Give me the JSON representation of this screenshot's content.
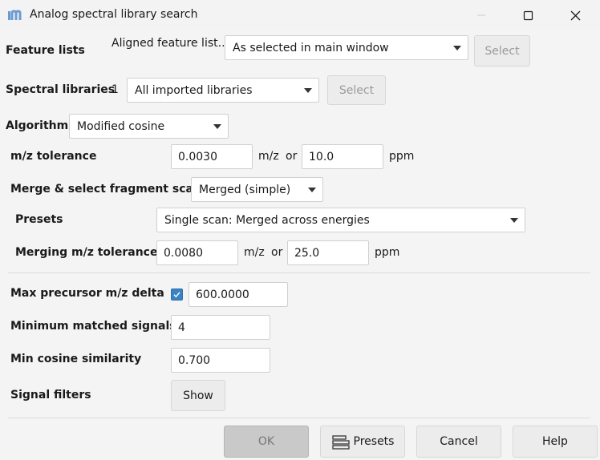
{
  "window": {
    "title": "Analog spectral library search",
    "app_icon": "mzmine-logo-icon",
    "controls": [
      "minimize-icon",
      "maximize-icon",
      "close-icon"
    ]
  },
  "feature_lists": {
    "label": "Feature lists",
    "sublabel": "Aligned feature list...",
    "combo_value": "As selected in main window",
    "select_label": "Select"
  },
  "spectral_libraries": {
    "label": "Spectral libraries",
    "count": "1",
    "combo_value": "All imported libraries",
    "select_label": "Select"
  },
  "algorithm": {
    "label": "Algorithm",
    "combo_value": "Modified cosine"
  },
  "mz_tolerance": {
    "label": "m/z tolerance",
    "mz_value": "0.0030",
    "mz_unit": "m/z",
    "or": "or",
    "ppm_value": "10.0",
    "ppm_unit": "ppm"
  },
  "merge": {
    "label": "Merge & select fragment scans",
    "combo_value": "Merged (simple)"
  },
  "presets": {
    "label": "Presets",
    "combo_value": "Single scan: Merged across energies"
  },
  "merging_mz_tolerance": {
    "label": "Merging m/z tolerance",
    "mz_value": "0.0080",
    "mz_unit": "m/z",
    "or": "or",
    "ppm_value": "25.0",
    "ppm_unit": "ppm"
  },
  "max_precursor": {
    "label": "Max precursor m/z delta",
    "checked": true,
    "value": "600.0000"
  },
  "min_matched": {
    "label": "Minimum matched signals",
    "value": "4"
  },
  "min_cosine": {
    "label": "Min cosine similarity",
    "value": "0.700"
  },
  "signal_filters": {
    "label": "Signal filters",
    "show_label": "Show"
  },
  "footer": {
    "ok_label": "OK",
    "presets_label": "Presets",
    "cancel_label": "Cancel",
    "help_label": "Help"
  },
  "colors": {
    "accent": "#3b83c4",
    "background": "#f4f4f4"
  }
}
